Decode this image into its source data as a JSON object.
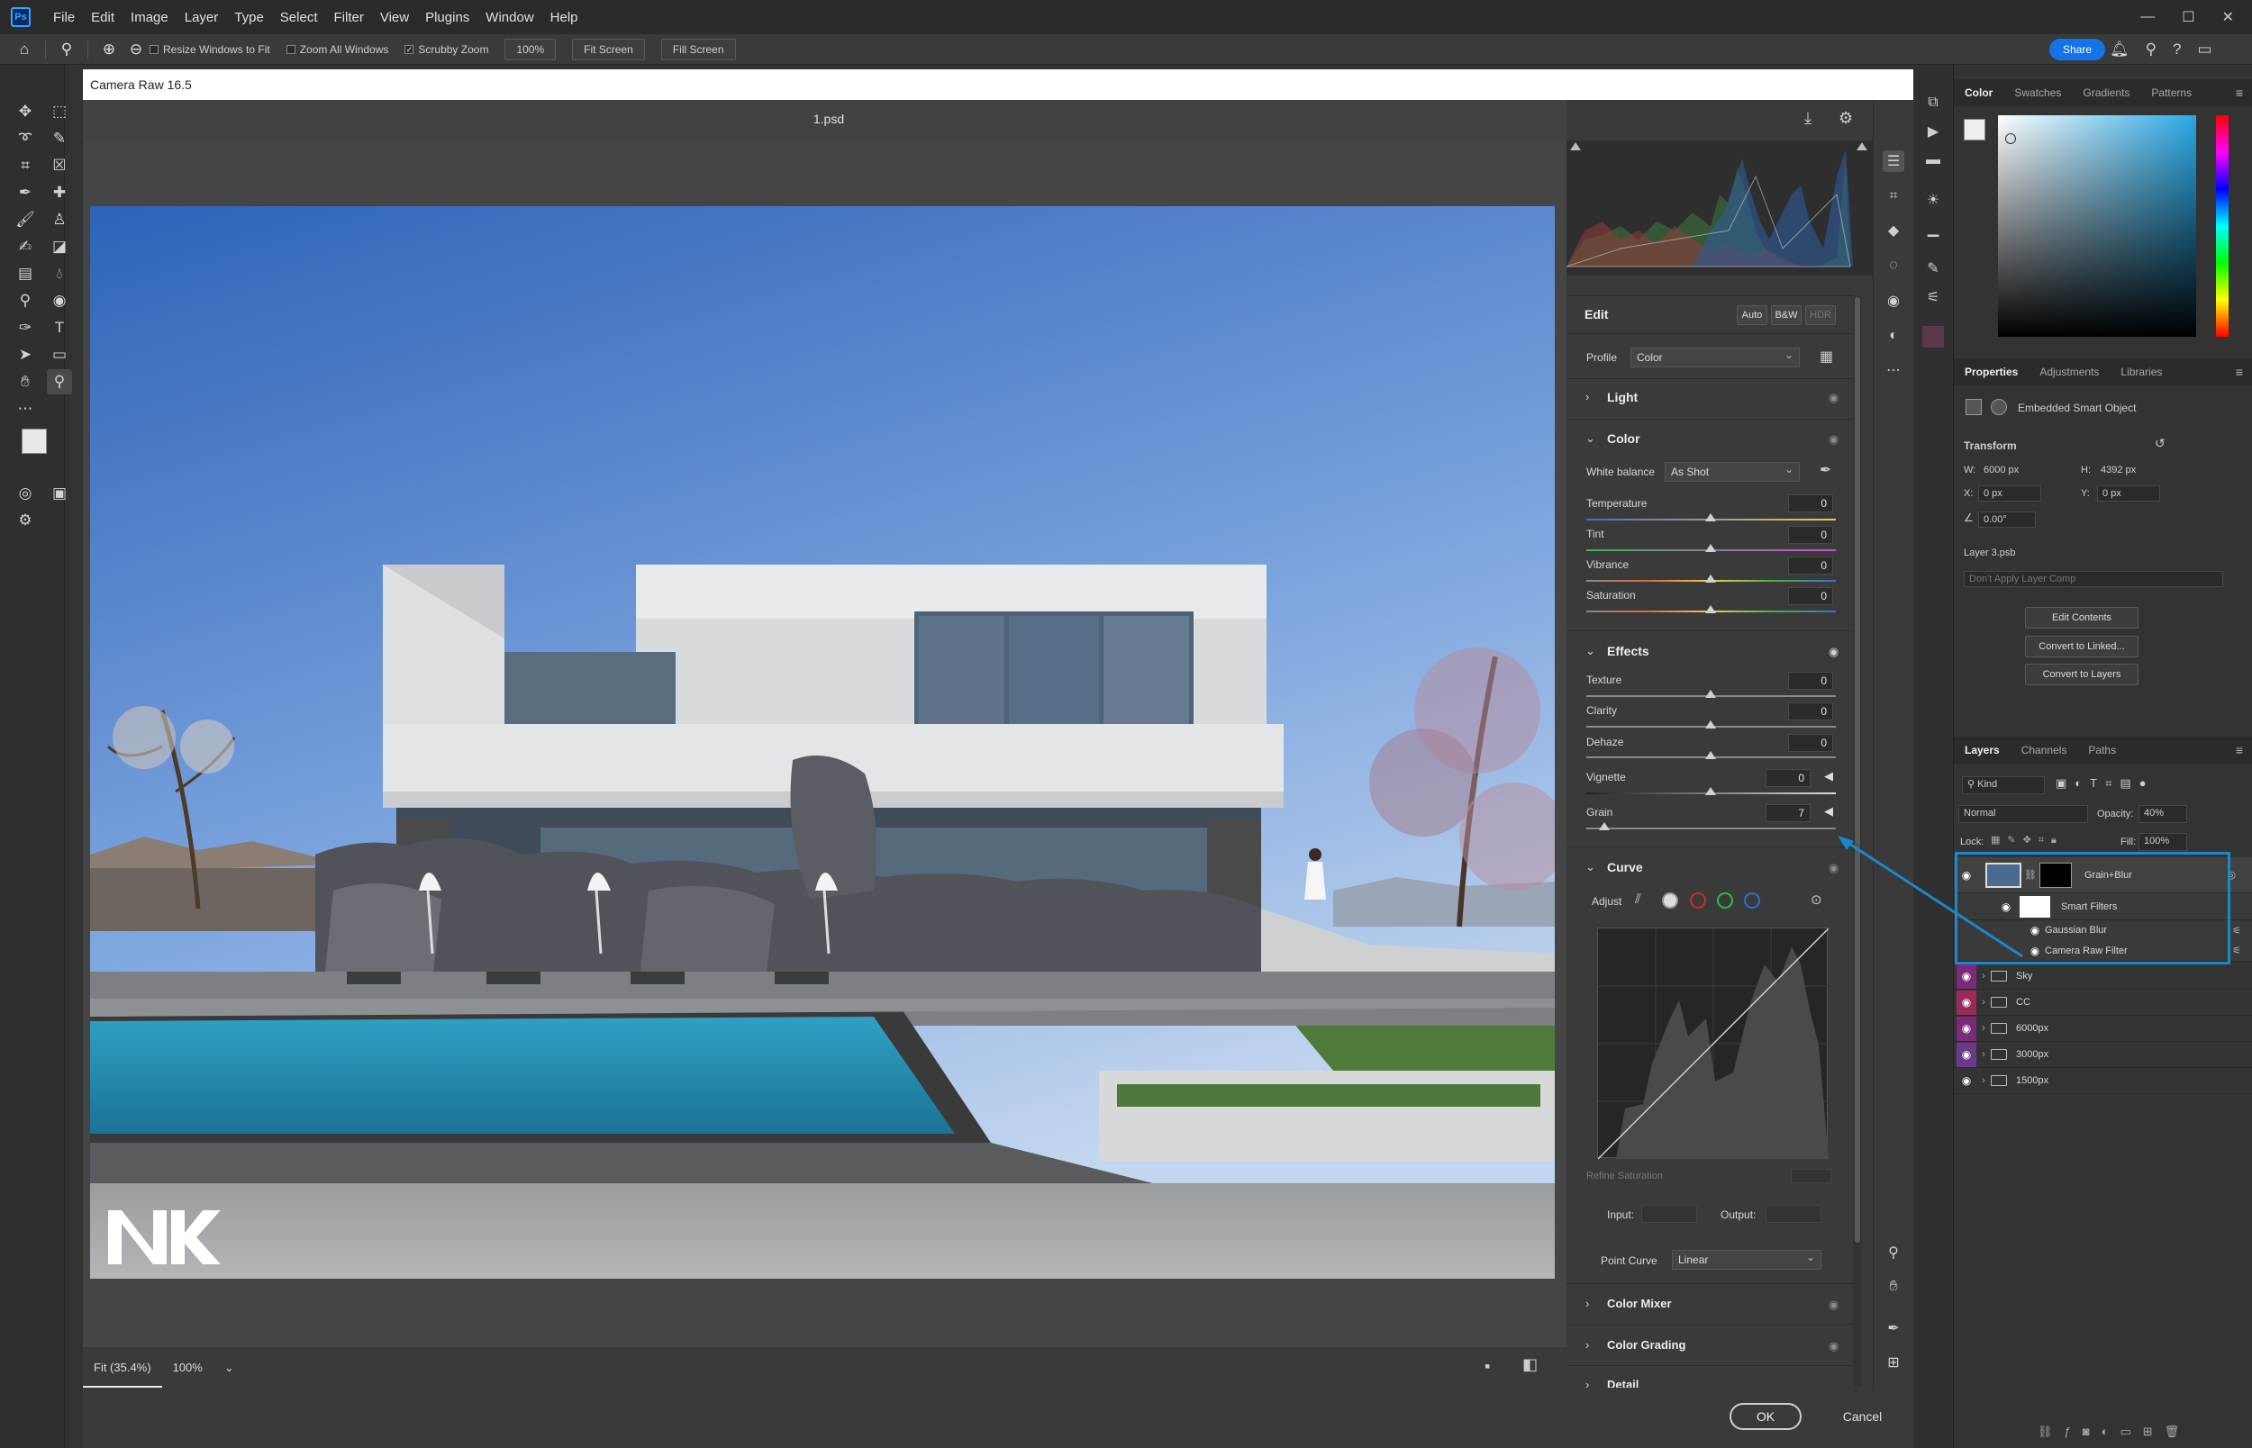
{
  "menubar": {
    "logo": "Ps",
    "items": [
      "File",
      "Edit",
      "Image",
      "Layer",
      "Type",
      "Select",
      "Filter",
      "View",
      "Plugins",
      "Window",
      "Help"
    ]
  },
  "options": {
    "resize_windows": "Resize Windows to Fit",
    "zoom_all": "Zoom All Windows",
    "scrubby": "Scrubby Zoom",
    "zoom_value": "100%",
    "fit_screen": "Fit Screen",
    "fill_screen": "Fill Screen",
    "share": "Share"
  },
  "camera_raw": {
    "title": "Camera Raw 16.5",
    "document": "1.psd",
    "zoom_fit": "Fit (35.4%)",
    "zoom_100": "100%",
    "ok": "OK",
    "cancel": "Cancel",
    "edit": {
      "heading": "Edit",
      "auto": "Auto",
      "bw": "B&W",
      "hdr": "HDR",
      "profile_label": "Profile",
      "profile_value": "Color",
      "light": "Light",
      "color": "Color",
      "white_balance_label": "White balance",
      "white_balance_value": "As Shot",
      "temperature": {
        "label": "Temperature",
        "value": "0"
      },
      "tint": {
        "label": "Tint",
        "value": "0"
      },
      "vibrance": {
        "label": "Vibrance",
        "value": "0"
      },
      "saturation": {
        "label": "Saturation",
        "value": "0"
      },
      "effects": "Effects",
      "texture": {
        "label": "Texture",
        "value": "0"
      },
      "clarity": {
        "label": "Clarity",
        "value": "0"
      },
      "dehaze": {
        "label": "Dehaze",
        "value": "0"
      },
      "vignette": {
        "label": "Vignette",
        "value": "0"
      },
      "grain": {
        "label": "Grain",
        "value": "7"
      },
      "curve": "Curve",
      "adjust": "Adjust",
      "refine_saturation": "Refine Saturation",
      "input_label": "Input:",
      "output_label": "Output:",
      "point_curve_label": "Point Curve",
      "point_curve_value": "Linear",
      "color_mixer": "Color Mixer",
      "color_grading": "Color Grading",
      "detail": "Detail"
    }
  },
  "panels": {
    "color_tabs": [
      "Color",
      "Swatches",
      "Gradients",
      "Patterns"
    ],
    "props_tabs": [
      "Properties",
      "Adjustments",
      "Libraries"
    ],
    "embedded": "Embedded Smart Object",
    "transform": "Transform",
    "w": "W:",
    "w_val": "6000 px",
    "h": "H:",
    "h_val": "4392 px",
    "x": "X:",
    "x_val": "0 px",
    "y": "Y:",
    "y_val": "0 px",
    "angle_val": "0.00°",
    "layer_name": "Layer 3.psb",
    "layer_comp": "Don't Apply Layer Comp",
    "edit_contents": "Edit Contents",
    "convert_linked": "Convert to Linked...",
    "convert_layers": "Convert to Layers",
    "layers_tabs": [
      "Layers",
      "Channels",
      "Paths"
    ],
    "kind": "Kind",
    "blend": "Normal",
    "opacity_label": "Opacity:",
    "opacity_val": "40%",
    "lock_label": "Lock:",
    "fill_label": "Fill:",
    "fill_val": "100%",
    "layers": {
      "grain_blur": "Grain+Blur",
      "smart_filters": "Smart Filters",
      "gaussian": "Gaussian Blur",
      "camera_raw_filter": "Camera Raw Filter",
      "groups": [
        "Sky",
        "CC",
        "6000px",
        "3000px",
        "1500px"
      ]
    }
  },
  "colors": {
    "accent": "#1473e6",
    "highlight": "#1a88cc",
    "sky_top": "#3a72c4",
    "sky_bottom": "#a9c6ec"
  }
}
